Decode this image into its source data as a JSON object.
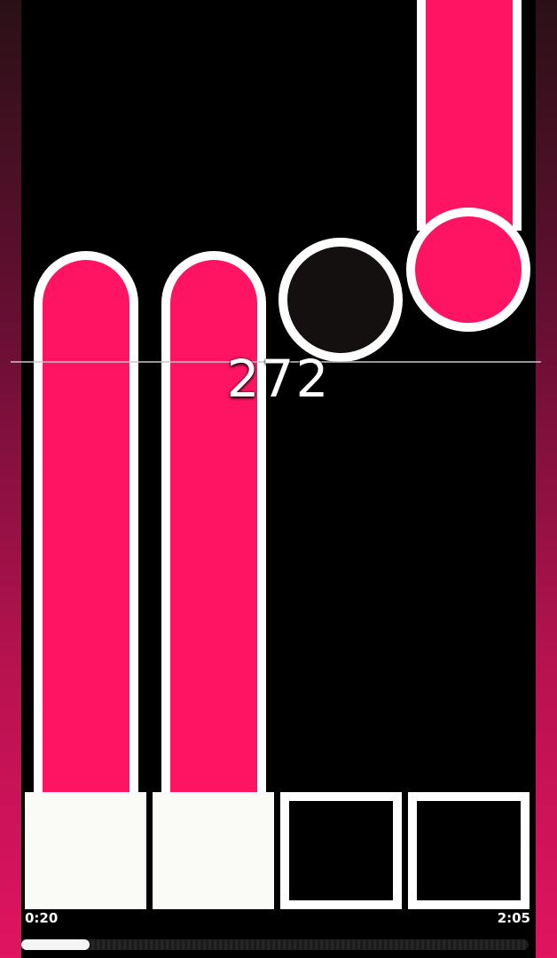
{
  "game": {
    "score": "272",
    "time_elapsed": "0:20",
    "time_total": "2:05",
    "progress_fraction": 0.135
  },
  "colors": {
    "tile_pink": "#ff1464",
    "tile_outline": "#ffffff",
    "background": "#000000",
    "side_gradient_bottom": "#e0145f"
  },
  "lanes": [
    {
      "lane": 1,
      "pad_state": "pressed",
      "note": "long-hold"
    },
    {
      "lane": 2,
      "pad_state": "pressed",
      "note": "long-hold"
    },
    {
      "lane": 3,
      "pad_state": "idle",
      "note": "single-tap-dark"
    },
    {
      "lane": 4,
      "pad_state": "idle",
      "note": "long-hold-incoming"
    }
  ]
}
